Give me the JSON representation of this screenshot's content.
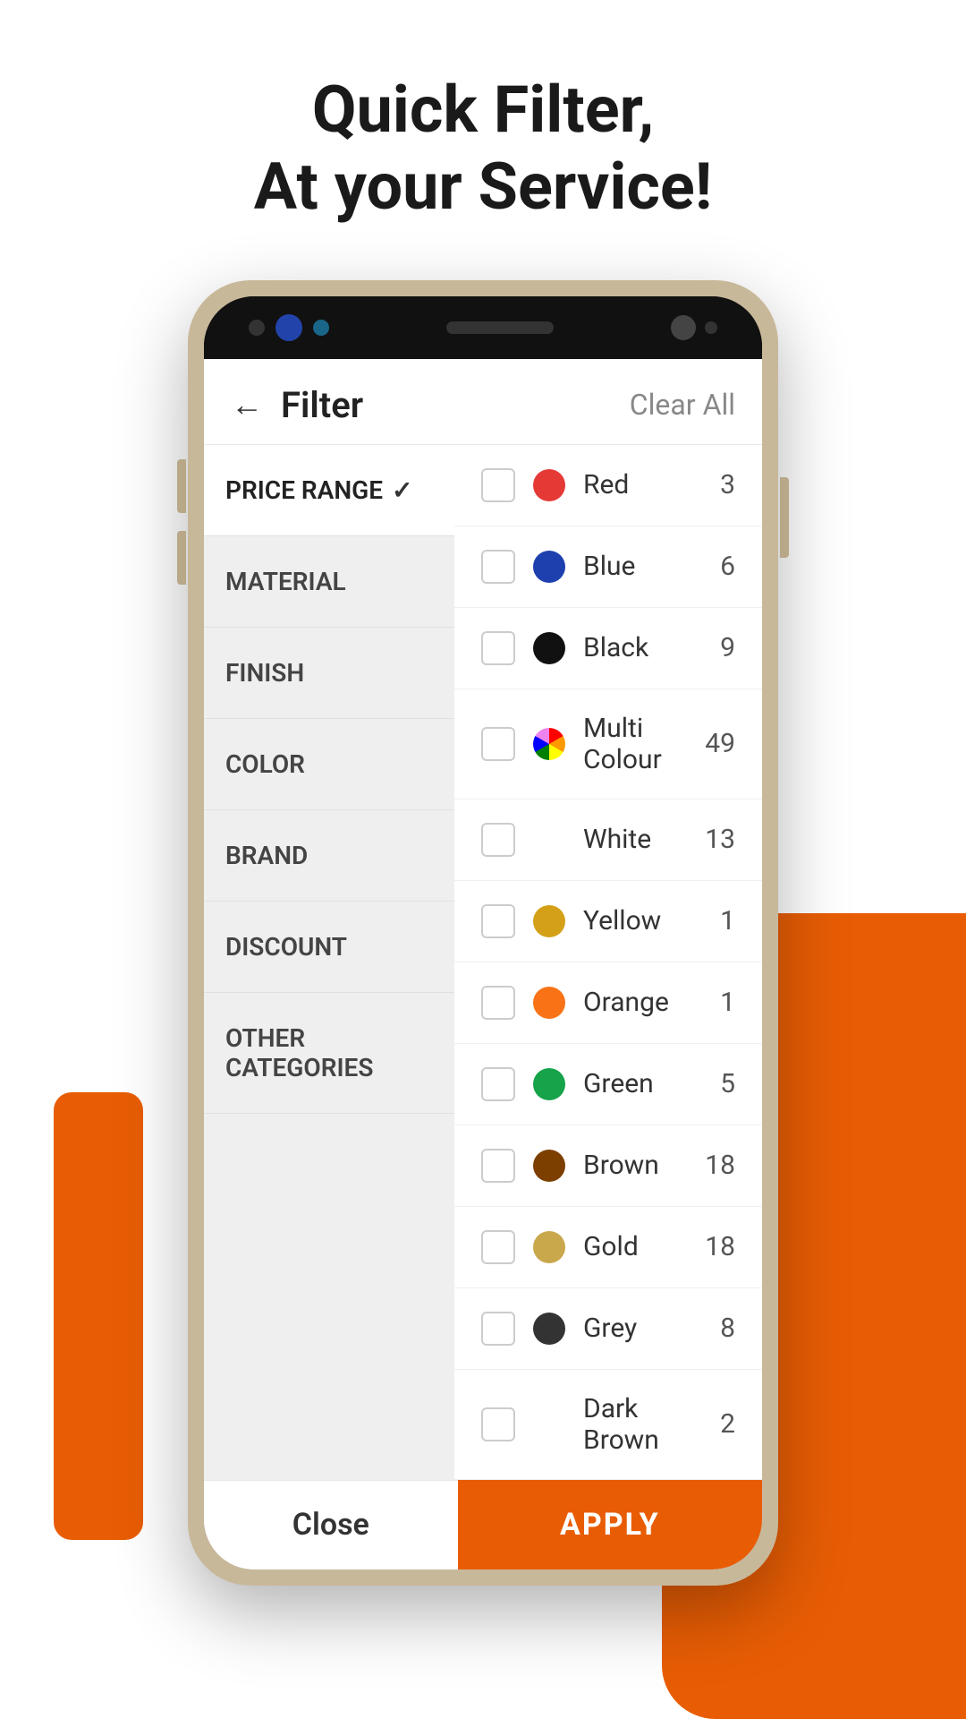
{
  "hero": {
    "line1": "Quick Filter,",
    "line2": "At your Service!"
  },
  "app": {
    "header": {
      "title": "Filter",
      "clear_all": "Clear All"
    },
    "sidebar": [
      {
        "id": "price-range",
        "label": "PRICE RANGE",
        "active": true,
        "checked": true
      },
      {
        "id": "material",
        "label": "MATERIAL",
        "active": false,
        "checked": false
      },
      {
        "id": "finish",
        "label": "FINISH",
        "active": false,
        "checked": false
      },
      {
        "id": "color",
        "label": "COLOR",
        "active": false,
        "checked": false
      },
      {
        "id": "brand",
        "label": "BRAND",
        "active": false,
        "checked": false
      },
      {
        "id": "discount",
        "label": "DISCOUNT",
        "active": false,
        "checked": false
      },
      {
        "id": "other-categories",
        "label": "OTHER CATEGORIES",
        "active": false,
        "checked": false
      }
    ],
    "colors": [
      {
        "name": "Red",
        "count": "3",
        "color": "#e53935",
        "type": "dot"
      },
      {
        "name": "Blue",
        "count": "6",
        "color": "#1e40af",
        "type": "dot"
      },
      {
        "name": "Black",
        "count": "9",
        "color": "#111111",
        "type": "dot"
      },
      {
        "name": "Multi Colour",
        "count": "49",
        "color": null,
        "type": "multi"
      },
      {
        "name": "White",
        "count": "13",
        "color": null,
        "type": "none"
      },
      {
        "name": "Yellow",
        "count": "1",
        "color": "#d4a017",
        "type": "dot"
      },
      {
        "name": "Orange",
        "count": "1",
        "color": "#f97316",
        "type": "dot"
      },
      {
        "name": "Green",
        "count": "5",
        "color": "#16a34a",
        "type": "dot"
      },
      {
        "name": "Brown",
        "count": "18",
        "color": "#7c3f00",
        "type": "dot"
      },
      {
        "name": "Gold",
        "count": "18",
        "color": "#c9a84c",
        "type": "dot"
      },
      {
        "name": "Grey",
        "count": "8",
        "color": "#333333",
        "type": "dot"
      },
      {
        "name": "Dark Brown",
        "count": "2",
        "color": null,
        "type": "none"
      }
    ],
    "bottom": {
      "close": "Close",
      "apply": "APPLY"
    }
  }
}
